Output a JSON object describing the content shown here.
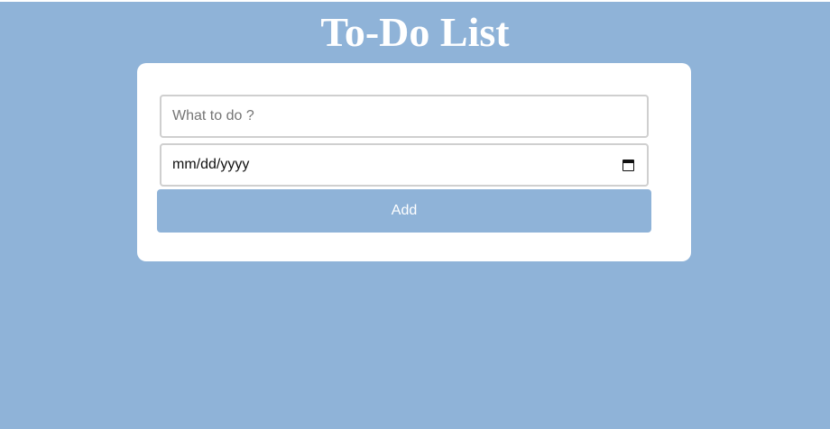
{
  "header": {
    "title": "To-Do List"
  },
  "form": {
    "task_placeholder": "What to do ?",
    "task_value": "",
    "date_value": "mm/dd/yyyy",
    "add_label": "Add"
  },
  "icons": {
    "calendar": "calendar-icon"
  },
  "colors": {
    "background": "#8fb3d8",
    "card": "#ffffff",
    "accent": "#8fb3d8",
    "input_border": "#cfcfcf"
  }
}
